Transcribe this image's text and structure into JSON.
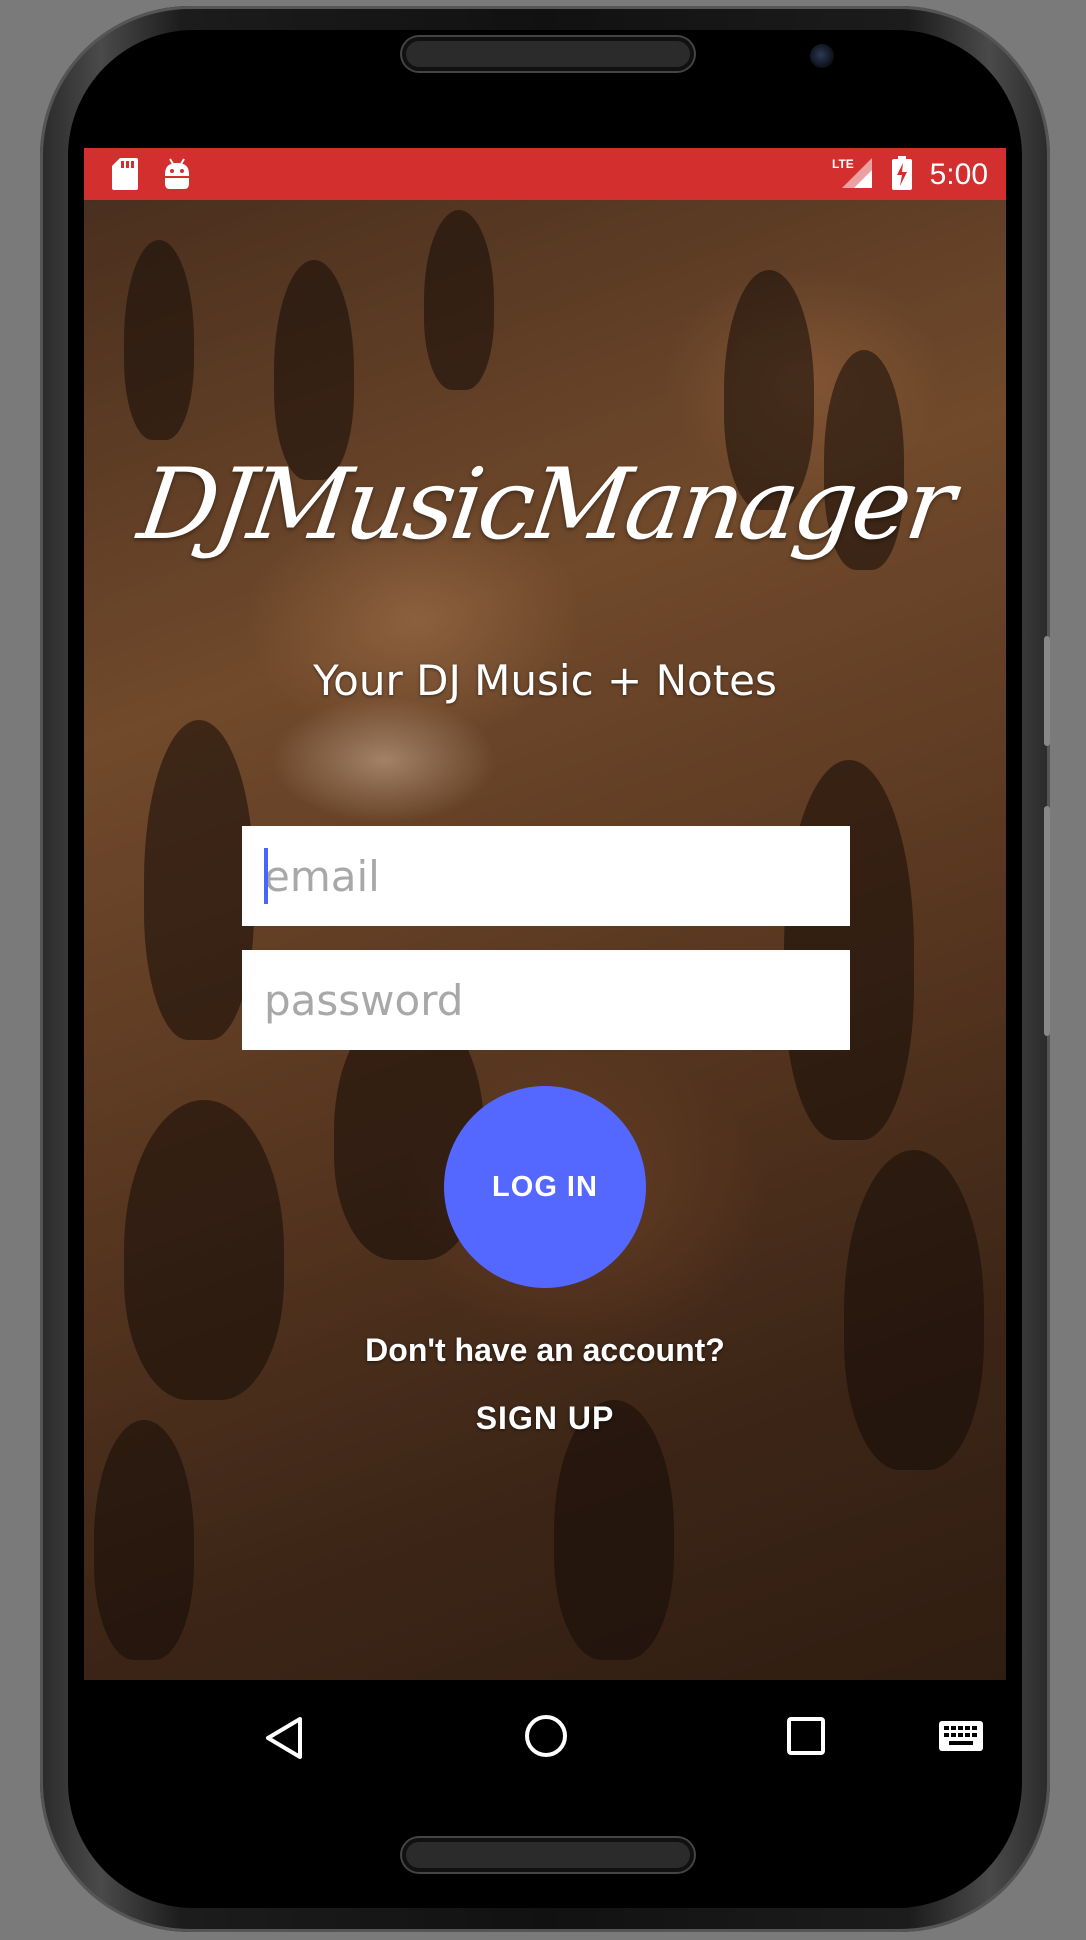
{
  "status_bar": {
    "time": "5:00",
    "network": "LTE",
    "color": "#d32f2f",
    "left_icons": [
      "sd-card-icon",
      "android-debug-icon"
    ],
    "right_icons": [
      "lte-signal-icon",
      "battery-charging-icon"
    ]
  },
  "app": {
    "title": "DJMusicManager",
    "subtitle": "Your DJ Music + Notes"
  },
  "login_form": {
    "email_placeholder": "email",
    "email_value": "",
    "password_placeholder": "password",
    "password_value": "",
    "login_label": "LOG IN",
    "login_color": "#5468ff"
  },
  "signup": {
    "prompt": "Don't have an account?",
    "link_label": "SIGN UP"
  },
  "navigation": {
    "buttons": [
      "back-icon",
      "home-icon",
      "recents-icon",
      "keyboard-icon"
    ]
  }
}
